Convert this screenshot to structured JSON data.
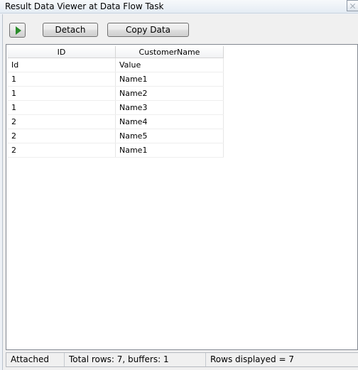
{
  "window": {
    "title": "Result Data Viewer at Data Flow Task"
  },
  "toolbar": {
    "play_icon": "play-icon",
    "detach_label": "Detach",
    "copy_label": "Copy Data"
  },
  "grid": {
    "columns": [
      "ID",
      "CustomerName"
    ],
    "rows": [
      [
        "Id",
        "Value"
      ],
      [
        "1",
        "Name1"
      ],
      [
        "1",
        "Name2"
      ],
      [
        "1",
        "Name3"
      ],
      [
        "2",
        "Name4"
      ],
      [
        "2",
        "Name5"
      ],
      [
        "2",
        "Name1"
      ]
    ]
  },
  "status": {
    "state": "Attached",
    "totals": "Total rows: 7, buffers: 1",
    "displayed": "Rows displayed = 7"
  },
  "colors": {
    "play_green": "#2a8c2a",
    "window_bg": "#f0f0f0",
    "grid_bg": "#ffffff"
  }
}
